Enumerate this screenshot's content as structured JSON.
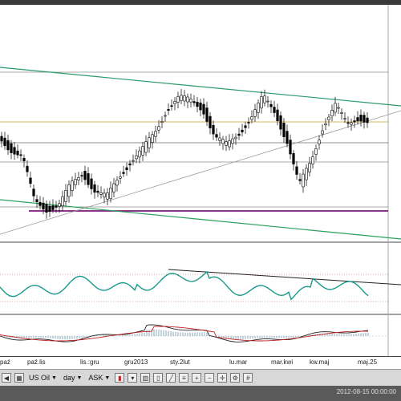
{
  "chart": {
    "x_labels": [
      "paź",
      "paź.lis",
      "lis.:gru",
      "gru2013",
      "sty.2lut",
      "lu.mar",
      "mar.kwi",
      "kw.maj",
      "maj.25"
    ]
  },
  "toolbar": {
    "symbol": "US Oil",
    "timeframe": "day",
    "price_side": "ASK",
    "icons": [
      "grid-icon",
      "bar-chart-icon",
      "candle-chart-icon",
      "line-chart-icon",
      "zoom-in-icon",
      "zoom-out-icon",
      "crosshair-icon",
      "settings-icon"
    ]
  },
  "status": {
    "timestamp": "2012-08-15 00:00:00"
  },
  "colors": {
    "candle": "#000000",
    "upper_trend": "#2a9a6a",
    "lower_channel": "#2aa05a",
    "level": "#c8a030",
    "support": "#7a1a7a",
    "oscillator": "#1a9a8a",
    "macd_signal": "#c02020"
  }
}
